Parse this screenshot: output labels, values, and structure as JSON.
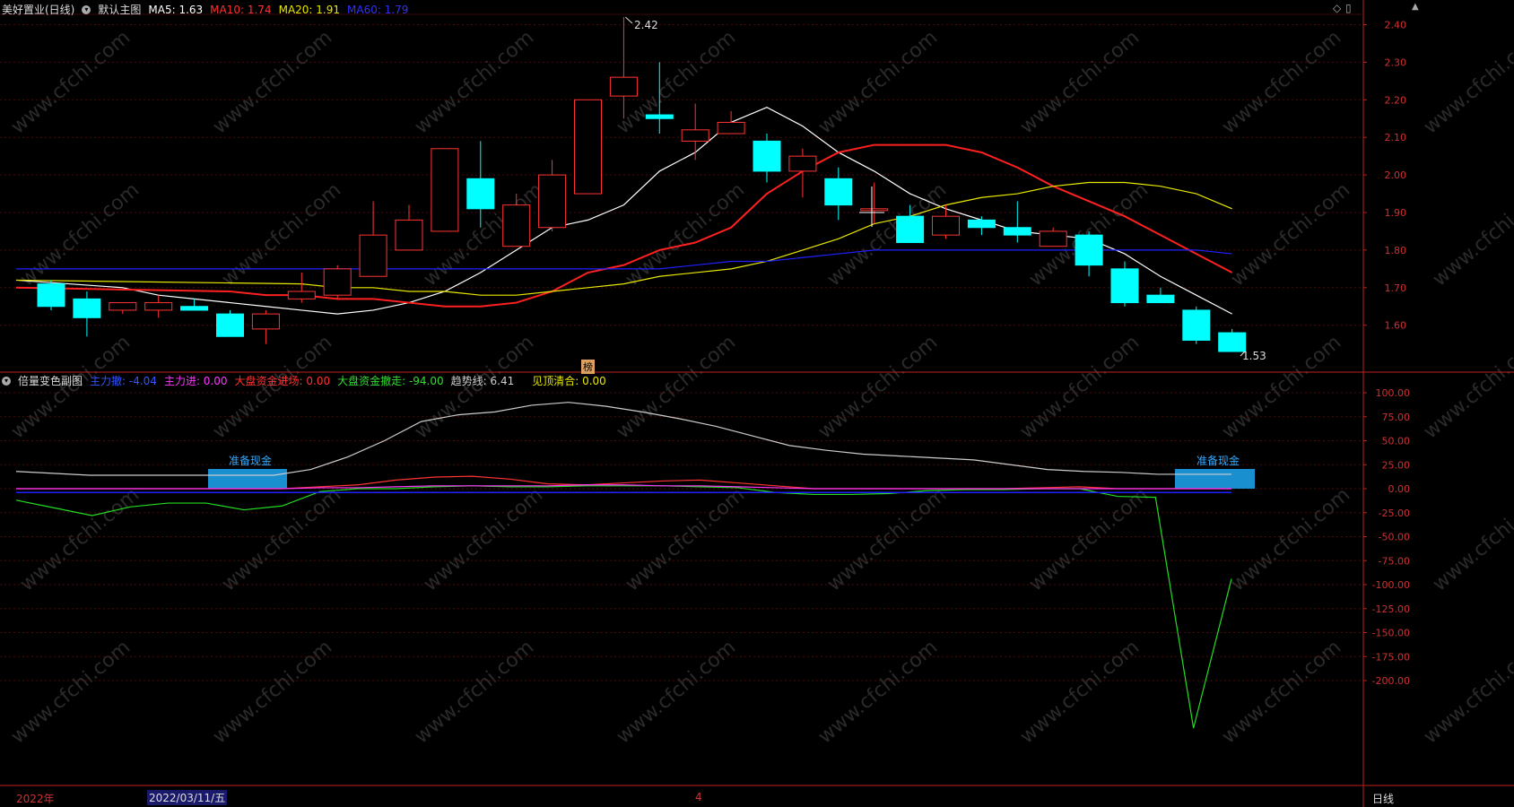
{
  "main_header": {
    "title": "美好置业(日线)",
    "chart_name": "默认主图",
    "ma5": "MA5: 1.63",
    "ma10": "MA10: 1.74",
    "ma20": "MA20: 1.91",
    "ma60": "MA60: 1.79"
  },
  "sub_header": {
    "title": "倍量变色副图",
    "items": [
      {
        "text": "主力撤: -4.04",
        "color": "#3355ff"
      },
      {
        "text": "主力进: 0.00",
        "color": "#ff33ff"
      },
      {
        "text": "大盘资金进场: 0.00",
        "color": "#ff3333"
      },
      {
        "text": "大盘资金撤走: -94.00",
        "color": "#33dd33"
      },
      {
        "text": "趋势线: 6.41",
        "color": "#cccccc"
      },
      {
        "text": "见顶清合: 0.00",
        "color": "#e8e800"
      }
    ]
  },
  "markers": {
    "high_label": "2.42",
    "low_label": "1.53",
    "badge": "榜",
    "box_label_1": "准备现金",
    "box_label_2": "准备现金"
  },
  "bottom": {
    "year": "2022年",
    "date": "2022/03/11/五",
    "month": "4",
    "period": "日线"
  },
  "watermark": "www.cfchi.com",
  "colors": {
    "up": "#ff3333",
    "down": "#00ffff",
    "ma5": "#ffffff",
    "ma10": "#ff2020",
    "ma20": "#e8e800",
    "ma60": "#2020ff",
    "axis": "#c02020",
    "trend": "#cccccc",
    "green": "#22dd22"
  },
  "chart_data": [
    {
      "type": "candlestick",
      "title": "美好置业(日线)",
      "ylim": [
        1.52,
        2.45
      ],
      "yticks": [
        "2.40",
        "2.30",
        "2.20",
        "2.10",
        "2.00",
        "1.90",
        "1.80",
        "1.70",
        "1.60"
      ],
      "candles": [
        {
          "o": 1.71,
          "h": 1.72,
          "l": 1.64,
          "c": 1.65
        },
        {
          "o": 1.67,
          "h": 1.69,
          "l": 1.57,
          "c": 1.62
        },
        {
          "o": 1.64,
          "h": 1.66,
          "l": 1.63,
          "c": 1.66
        },
        {
          "o": 1.64,
          "h": 1.68,
          "l": 1.62,
          "c": 1.66
        },
        {
          "o": 1.65,
          "h": 1.67,
          "l": 1.64,
          "c": 1.64
        },
        {
          "o": 1.63,
          "h": 1.64,
          "l": 1.57,
          "c": 1.57
        },
        {
          "o": 1.59,
          "h": 1.64,
          "l": 1.55,
          "c": 1.63
        },
        {
          "o": 1.67,
          "h": 1.74,
          "l": 1.66,
          "c": 1.69
        },
        {
          "o": 1.68,
          "h": 1.76,
          "l": 1.67,
          "c": 1.75
        },
        {
          "o": 1.73,
          "h": 1.93,
          "l": 1.73,
          "c": 1.84
        },
        {
          "o": 1.8,
          "h": 1.92,
          "l": 1.8,
          "c": 1.88
        },
        {
          "o": 1.85,
          "h": 2.07,
          "l": 1.85,
          "c": 2.07
        },
        {
          "o": 1.99,
          "h": 2.09,
          "l": 1.86,
          "c": 1.91
        },
        {
          "o": 1.81,
          "h": 1.95,
          "l": 1.81,
          "c": 1.92
        },
        {
          "o": 1.86,
          "h": 2.04,
          "l": 1.85,
          "c": 2.0
        },
        {
          "o": 1.95,
          "h": 2.2,
          "l": 1.95,
          "c": 2.2
        },
        {
          "o": 2.21,
          "h": 2.42,
          "l": 2.15,
          "c": 2.26
        },
        {
          "o": 2.16,
          "h": 2.3,
          "l": 2.11,
          "c": 2.15
        },
        {
          "o": 2.09,
          "h": 2.19,
          "l": 2.04,
          "c": 2.12
        },
        {
          "o": 2.11,
          "h": 2.17,
          "l": 2.11,
          "c": 2.14
        },
        {
          "o": 2.09,
          "h": 2.11,
          "l": 1.98,
          "c": 2.01
        },
        {
          "o": 2.01,
          "h": 2.07,
          "l": 1.94,
          "c": 2.05
        },
        {
          "o": 1.99,
          "h": 2.02,
          "l": 1.88,
          "c": 1.92
        },
        {
          "o": 1.91,
          "h": 1.98,
          "l": 1.87,
          "c": 1.91
        },
        {
          "o": 1.89,
          "h": 1.92,
          "l": 1.82,
          "c": 1.82
        },
        {
          "o": 1.84,
          "h": 1.92,
          "l": 1.83,
          "c": 1.89
        },
        {
          "o": 1.88,
          "h": 1.89,
          "l": 1.84,
          "c": 1.86
        },
        {
          "o": 1.86,
          "h": 1.93,
          "l": 1.82,
          "c": 1.84
        },
        {
          "o": 1.81,
          "h": 1.86,
          "l": 1.81,
          "c": 1.85
        },
        {
          "o": 1.84,
          "h": 1.85,
          "l": 1.73,
          "c": 1.76
        },
        {
          "o": 1.75,
          "h": 1.77,
          "l": 1.65,
          "c": 1.66
        },
        {
          "o": 1.68,
          "h": 1.7,
          "l": 1.66,
          "c": 1.66
        },
        {
          "o": 1.64,
          "h": 1.65,
          "l": 1.55,
          "c": 1.56
        },
        {
          "o": 1.58,
          "h": 1.59,
          "l": 1.53,
          "c": 1.53
        }
      ],
      "series": [
        {
          "name": "MA5",
          "values": [
            1.72,
            1.7,
            1.68,
            1.67,
            1.66,
            1.65,
            1.64,
            1.63,
            1.64,
            1.66,
            1.69,
            1.74,
            1.8,
            1.86,
            1.88,
            1.92,
            2.01,
            2.06,
            2.14,
            2.18,
            2.13,
            2.06,
            2.01,
            1.95,
            1.91,
            1.88,
            1.85,
            1.84,
            1.83,
            1.79,
            1.73,
            1.68,
            1.63
          ]
        },
        {
          "name": "MA10",
          "values": [
            1.7,
            1.69,
            1.68,
            1.68,
            1.67,
            1.67,
            1.66,
            1.65,
            1.65,
            1.66,
            1.69,
            1.74,
            1.76,
            1.8,
            1.82,
            1.86,
            1.95,
            2.01,
            2.06,
            2.08,
            2.08,
            2.08,
            2.06,
            2.02,
            1.97,
            1.93,
            1.89,
            1.84,
            1.79,
            1.74
          ]
        },
        {
          "name": "MA20",
          "values": [
            1.72,
            1.71,
            1.7,
            1.7,
            1.69,
            1.69,
            1.68,
            1.68,
            1.69,
            1.7,
            1.71,
            1.73,
            1.74,
            1.75,
            1.77,
            1.8,
            1.83,
            1.87,
            1.89,
            1.92,
            1.94,
            1.95,
            1.97,
            1.98,
            1.98,
            1.97,
            1.95,
            1.91
          ]
        },
        {
          "name": "MA60",
          "values": [
            1.75,
            1.75,
            1.75,
            1.75,
            1.75,
            1.75,
            1.75,
            1.75,
            1.76,
            1.77,
            1.77,
            1.78,
            1.79,
            1.8,
            1.8,
            1.8,
            1.8,
            1.8,
            1.8,
            1.8,
            1.8,
            1.8,
            1.8,
            1.79
          ]
        }
      ]
    },
    {
      "type": "line",
      "title": "倍量变色副图",
      "ylim": [
        -250,
        110
      ],
      "yticks": [
        "100.00",
        "75.00",
        "50.00",
        "25.00",
        "0.00",
        "-25.00",
        "-50.00",
        "-75.00",
        "-100.00",
        "-125.00",
        "-150.00",
        "-175.00",
        "-200.00"
      ],
      "series": [
        {
          "name": "趋势线",
          "values": [
            18,
            16,
            14,
            14,
            14,
            14,
            14,
            14,
            20,
            33,
            50,
            70,
            77,
            80,
            87,
            90,
            86,
            80,
            73,
            65,
            55,
            45,
            40,
            36,
            34,
            32,
            30,
            25,
            20,
            18,
            17,
            15,
            15,
            15
          ]
        },
        {
          "name": "大盘资金撤走",
          "values": [
            -12,
            -20,
            -28,
            -19,
            -15,
            -15,
            -22,
            -18,
            -3,
            0,
            0,
            2,
            3,
            2,
            2,
            3,
            3,
            3,
            2,
            1,
            -4,
            -6,
            -6,
            -5,
            -2,
            -1,
            -1,
            0,
            0,
            -8,
            -9,
            -250,
            -94
          ]
        },
        {
          "name": "大盘资金进场",
          "values": [
            0,
            0,
            0,
            0,
            0,
            0,
            0,
            0,
            2,
            4,
            9,
            12,
            13,
            10,
            5,
            4,
            6,
            8,
            9,
            6,
            3,
            0,
            0,
            0,
            0,
            0,
            0,
            1,
            2,
            0,
            0,
            0,
            0
          ]
        },
        {
          "name": "主力进",
          "values": [
            0,
            0,
            0,
            0,
            0,
            0,
            0,
            0,
            1,
            1,
            2,
            3,
            3,
            3,
            3,
            4,
            4,
            3,
            3,
            2,
            1,
            0,
            0,
            0,
            0,
            0,
            0,
            0,
            0,
            0,
            0,
            0,
            0
          ]
        },
        {
          "name": "主力撤",
          "values": [
            -4,
            -4,
            -4,
            -4,
            -4,
            -4,
            -4,
            -4,
            -4,
            -4,
            -4,
            -4,
            -4,
            -4,
            -4,
            -4,
            -4,
            -4,
            -4,
            -4,
            -4,
            -4,
            -4,
            -4,
            -4,
            -4,
            -4,
            -4,
            -4,
            -4,
            -4,
            -4,
            -4
          ]
        }
      ]
    }
  ]
}
